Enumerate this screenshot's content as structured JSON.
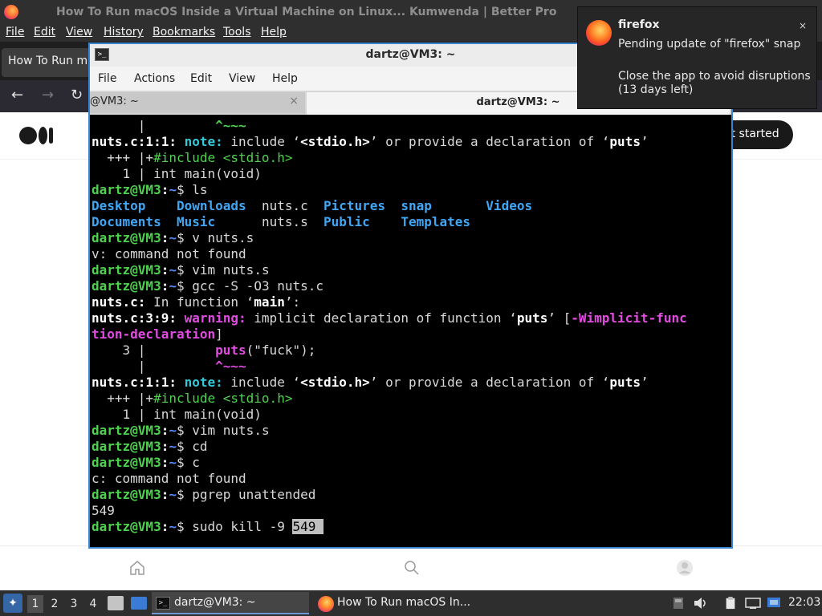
{
  "firefox": {
    "window_title": "How To Run macOS Inside a Virtual Machine on Linux...  Kumwenda | Better Pro",
    "menu": [
      {
        "label": "File",
        "underline": true
      },
      {
        "label": "Edit",
        "underline": true
      },
      {
        "label": "View",
        "underline": true
      },
      {
        "label": "History",
        "underline": true
      },
      {
        "label": "Bookmarks",
        "underline": true
      },
      {
        "label": "Tools",
        "underline": true
      },
      {
        "label": "Help",
        "underline": true
      }
    ],
    "tab_title": "How To Run ma",
    "page": {
      "get_started": "et started"
    }
  },
  "terminal": {
    "window_title": "dartz@VM3: ~",
    "menu": [
      "File",
      "Actions",
      "Edit",
      "View",
      "Help"
    ],
    "tabs": [
      {
        "label": "@VM3: ~",
        "close": "×"
      },
      {
        "label": "dartz@VM3: ~"
      }
    ],
    "lines": [
      [
        {
          "t": "      |         "
        },
        {
          "t": "^~~~",
          "c": "g"
        }
      ],
      [
        {
          "t": "nuts.c:1:1: ",
          "c": "w"
        },
        {
          "t": "note:",
          "c": "c"
        },
        {
          "t": " include ‘"
        },
        {
          "t": "<stdio.h>",
          "c": "w"
        },
        {
          "t": "’ or provide a declaration of ‘"
        },
        {
          "t": "puts",
          "c": "w"
        },
        {
          "t": "’"
        }
      ],
      [
        {
          "t": "  +++ |+"
        },
        {
          "t": "#include <stdio.h>",
          "c": "gr"
        }
      ],
      [
        {
          "t": "    1 | int main(void)"
        }
      ],
      [
        {
          "t": "dartz@VM3",
          "c": "g"
        },
        {
          "t": ":",
          "c": "w"
        },
        {
          "t": "~",
          "c": "b"
        },
        {
          "t": "$ ls"
        }
      ],
      [
        {
          "t": "Desktop    ",
          "c": "bl"
        },
        {
          "t": "Downloads",
          "c": "bl"
        },
        {
          "t": "  nuts.c  "
        },
        {
          "t": "Pictures",
          "c": "bl"
        },
        {
          "t": "  "
        },
        {
          "t": "snap",
          "c": "bl"
        },
        {
          "t": "       "
        },
        {
          "t": "Videos",
          "c": "bl"
        }
      ],
      [
        {
          "t": "Documents  ",
          "c": "bl"
        },
        {
          "t": "Music    ",
          "c": "bl"
        },
        {
          "t": "  nuts.s  "
        },
        {
          "t": "Public  ",
          "c": "bl"
        },
        {
          "t": "  "
        },
        {
          "t": "Templates",
          "c": "bl"
        }
      ],
      [
        {
          "t": "dartz@VM3",
          "c": "g"
        },
        {
          "t": ":",
          "c": "w"
        },
        {
          "t": "~",
          "c": "b"
        },
        {
          "t": "$ v nuts.s"
        }
      ],
      [
        {
          "t": "v: command not found"
        }
      ],
      [
        {
          "t": "dartz@VM3",
          "c": "g"
        },
        {
          "t": ":",
          "c": "w"
        },
        {
          "t": "~",
          "c": "b"
        },
        {
          "t": "$ vim nuts.s"
        }
      ],
      [
        {
          "t": "dartz@VM3",
          "c": "g"
        },
        {
          "t": ":",
          "c": "w"
        },
        {
          "t": "~",
          "c": "b"
        },
        {
          "t": "$ gcc -S -O3 nuts.c"
        }
      ],
      [
        {
          "t": "nuts.c:",
          "c": "w"
        },
        {
          "t": " In function ‘"
        },
        {
          "t": "main",
          "c": "w"
        },
        {
          "t": "’:"
        }
      ],
      [
        {
          "t": "nuts.c:3:9: ",
          "c": "w"
        },
        {
          "t": "warning:",
          "c": "m"
        },
        {
          "t": " implicit declaration of function ‘"
        },
        {
          "t": "puts",
          "c": "w"
        },
        {
          "t": "’ ["
        },
        {
          "t": "-Wimplicit-func",
          "c": "m"
        }
      ],
      [
        {
          "t": "tion-declaration",
          "c": "m"
        },
        {
          "t": "]"
        }
      ],
      [
        {
          "t": "    3 |         "
        },
        {
          "t": "puts",
          "c": "m"
        },
        {
          "t": "(\"fuck\");"
        }
      ],
      [
        {
          "t": "      |         "
        },
        {
          "t": "^~~~",
          "c": "m"
        }
      ],
      [
        {
          "t": "nuts.c:1:1: ",
          "c": "w"
        },
        {
          "t": "note:",
          "c": "c"
        },
        {
          "t": " include ‘"
        },
        {
          "t": "<stdio.h>",
          "c": "w"
        },
        {
          "t": "’ or provide a declaration of ‘"
        },
        {
          "t": "puts",
          "c": "w"
        },
        {
          "t": "’"
        }
      ],
      [
        {
          "t": "  +++ |+"
        },
        {
          "t": "#include <stdio.h>",
          "c": "gr"
        }
      ],
      [
        {
          "t": "    1 | int main(void)"
        }
      ],
      [
        {
          "t": "dartz@VM3",
          "c": "g"
        },
        {
          "t": ":",
          "c": "w"
        },
        {
          "t": "~",
          "c": "b"
        },
        {
          "t": "$ vim nuts.s"
        }
      ],
      [
        {
          "t": "dartz@VM3",
          "c": "g"
        },
        {
          "t": ":",
          "c": "w"
        },
        {
          "t": "~",
          "c": "b"
        },
        {
          "t": "$ cd"
        }
      ],
      [
        {
          "t": "dartz@VM3",
          "c": "g"
        },
        {
          "t": ":",
          "c": "w"
        },
        {
          "t": "~",
          "c": "b"
        },
        {
          "t": "$ c"
        }
      ],
      [
        {
          "t": "c: command not found"
        }
      ],
      [
        {
          "t": "dartz@VM3",
          "c": "g"
        },
        {
          "t": ":",
          "c": "w"
        },
        {
          "t": "~",
          "c": "b"
        },
        {
          "t": "$ pgrep unattended"
        }
      ],
      [
        {
          "t": "549"
        }
      ],
      [
        {
          "t": "dartz@VM3",
          "c": "g"
        },
        {
          "t": ":",
          "c": "w"
        },
        {
          "t": "~",
          "c": "b"
        },
        {
          "t": "$ sudo kill -9 "
        },
        {
          "t": "549 ",
          "c": "sel"
        }
      ]
    ]
  },
  "notification": {
    "app": "firefox",
    "close": "×",
    "line1": "Pending update of \"firefox\" snap",
    "line2": "Close the app to avoid disruptions (13 days left)",
    "icon": "firefox-icon"
  },
  "taskbar": {
    "workspaces": [
      "1",
      "2",
      "3",
      "4"
    ],
    "active_workspace": "1",
    "tasks": [
      {
        "label": "dartz@VM3: ~",
        "icon": "terminal-icon"
      },
      {
        "label": "How To Run macOS In...",
        "icon": "firefox-icon"
      }
    ],
    "clock": "22:03"
  }
}
